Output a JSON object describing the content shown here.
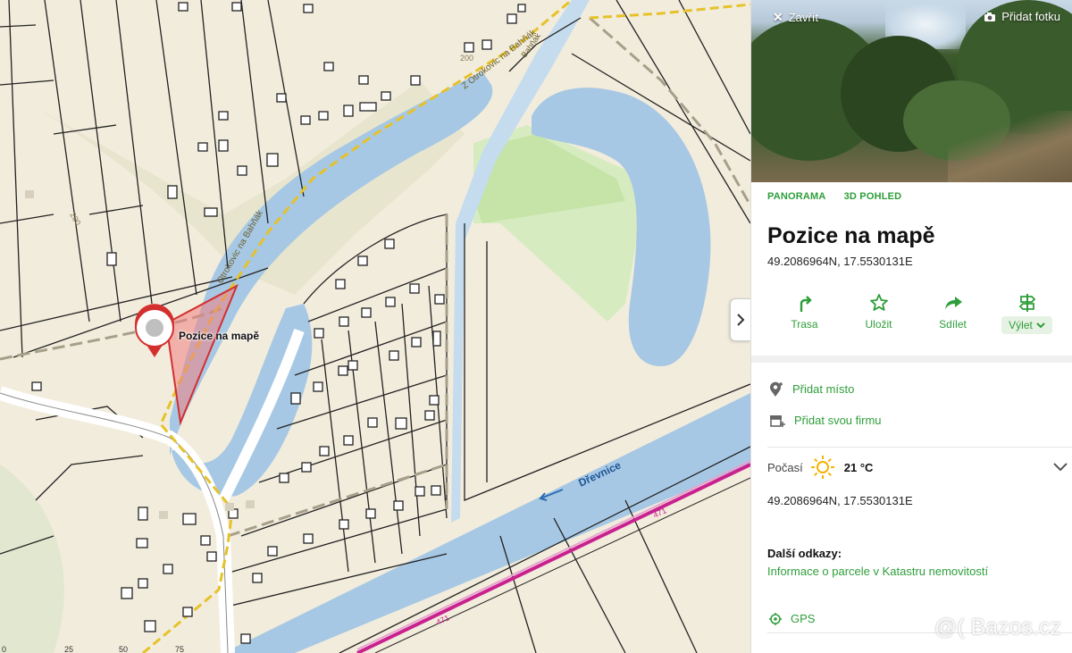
{
  "map": {
    "pin_label": "Pozice na mapě",
    "street_labels": [
      "Z Otrokovic na Bahňák",
      "Otrokovic na Bahňák",
      "Bahňák"
    ],
    "river_label": "Dřevnice",
    "contour_labels": [
      "200",
      "200"
    ],
    "road_number": "471",
    "scale_ticks": [
      "0",
      "25",
      "50",
      "75"
    ],
    "colors": {
      "land": "#f2ecdc",
      "water": "#a7c8e4",
      "meadow": "#d6ecc0",
      "parcel_line": "#222222",
      "pin_red": "#d32f2f",
      "road_yellow": "#e6c229",
      "rail_magenta": "#c9218f"
    }
  },
  "panel": {
    "close_label": "Zavřít",
    "add_photo_label": "Přidat fotku",
    "tabs": [
      "PANORAMA",
      "3D POHLED"
    ],
    "title": "Pozice na mapě",
    "coords": "49.2086964N, 17.5530131E",
    "actions": [
      {
        "label": "Trasa",
        "icon": "route-icon"
      },
      {
        "label": "Uložit",
        "icon": "star-icon"
      },
      {
        "label": "Sdílet",
        "icon": "share-icon"
      },
      {
        "label": "Výlet",
        "icon": "signpost-icon"
      }
    ],
    "add_place_label": "Přidat místo",
    "add_business_label": "Přidat svou firmu",
    "weather_label": "Počasí",
    "temperature": "21 °C",
    "coords_bottom": "49.2086964N, 17.5530131E",
    "more_links_title": "Další odkazy:",
    "cadastre_link": "Informace o parcele v Katastru nemovitostí",
    "gps_label": "GPS",
    "accent": "#2e9e3a"
  },
  "watermark": "@( Bazos.cz"
}
